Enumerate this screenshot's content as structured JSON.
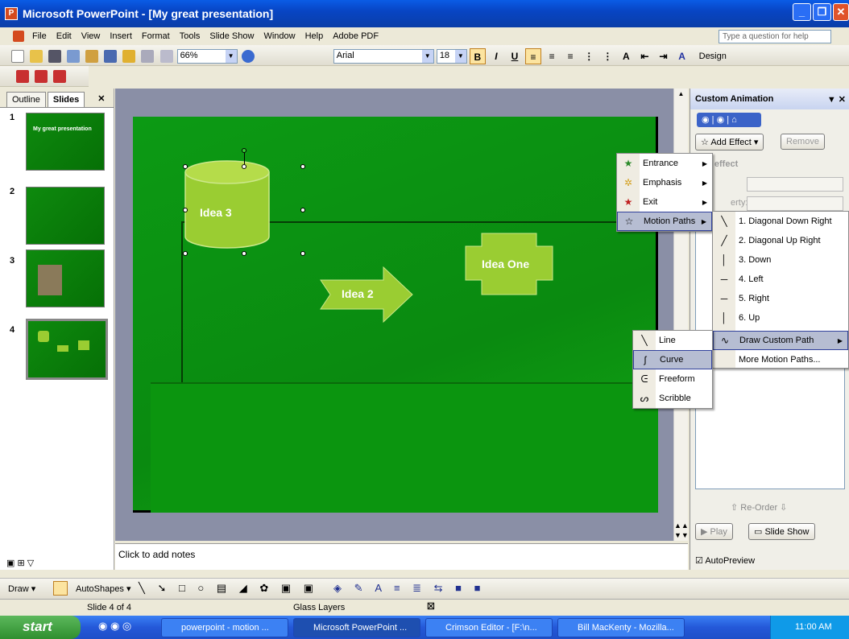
{
  "window": {
    "title": "Microsoft PowerPoint - [My great presentation]"
  },
  "menu": [
    "File",
    "Edit",
    "View",
    "Insert",
    "Format",
    "Tools",
    "Slide Show",
    "Window",
    "Help",
    "Adobe PDF"
  ],
  "help_placeholder": "Type a question for help",
  "toolbar": {
    "zoom": "66%",
    "font": "Arial",
    "size": "18",
    "design_label": "Design"
  },
  "left_panel": {
    "tabs": [
      "Outline",
      "Slides"
    ],
    "slide_numbers": [
      "1",
      "2",
      "3",
      "4"
    ]
  },
  "thumbnails": {
    "slide1_title": "My great presentation"
  },
  "slide": {
    "shapes": {
      "cylinder": "Idea 3",
      "arrow": "Idea 2",
      "cross": "Idea One"
    },
    "colors": {
      "background": "#0c9a14",
      "shape_fill": "#9acd32"
    }
  },
  "notes_placeholder": "Click to add notes",
  "task_pane": {
    "title": "Custom Animation",
    "add_effect": "Add Effect",
    "remove": "Remove",
    "modify_label": "ify effect",
    "prop_label": "erty:",
    "reorder": "Re-Order",
    "play": "Play",
    "slide_show": "Slide Show",
    "autopreview": "AutoPreview"
  },
  "effect_menu": [
    {
      "label": "Entrance",
      "icon": "entrance-icon"
    },
    {
      "label": "Emphasis",
      "icon": "emphasis-icon"
    },
    {
      "label": "Exit",
      "icon": "exit-icon"
    },
    {
      "label": "Motion Paths",
      "icon": "motion-paths-icon"
    }
  ],
  "motion_menu": [
    "1. Diagonal Down Right",
    "2. Diagonal Up Right",
    "3. Down",
    "4. Left",
    "5. Right",
    "6. Up",
    "Draw Custom Path",
    "More Motion Paths..."
  ],
  "custom_path_menu": [
    "Line",
    "Curve",
    "Freeform",
    "Scribble"
  ],
  "drawbar": {
    "draw": "Draw",
    "autoshapes": "AutoShapes"
  },
  "status": {
    "slide": "Slide 4 of 4",
    "design": "Glass Layers"
  },
  "taskbar": {
    "start": "start",
    "items": [
      "powerpoint - motion ...",
      "Microsoft PowerPoint ...",
      "Crimson Editor - [F:\\n...",
      "Bill MacKenty - Mozilla..."
    ],
    "time": "11:00 AM"
  }
}
